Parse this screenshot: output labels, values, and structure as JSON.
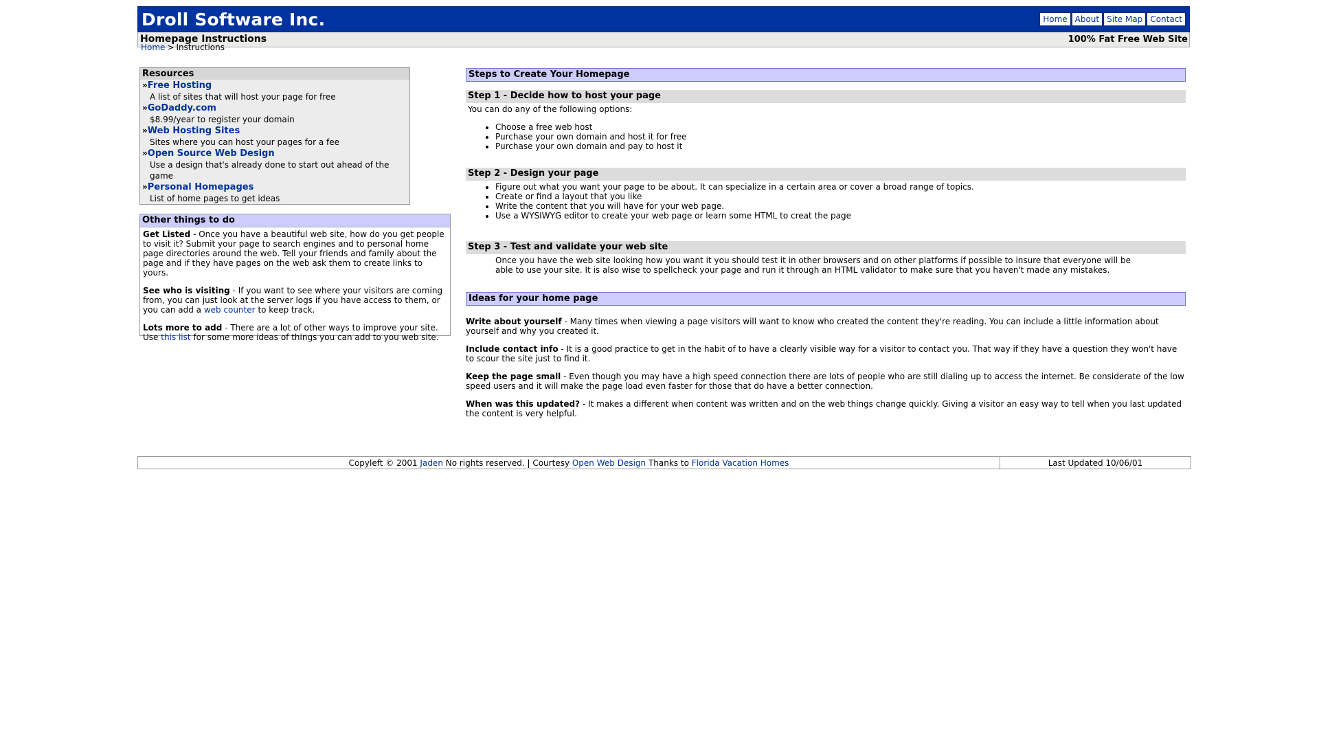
{
  "header": {
    "logo": "Droll Software Inc.",
    "nav": [
      "Home",
      "About",
      "Site Map",
      "Contact"
    ]
  },
  "subheader": {
    "left": "Homepage Instructions",
    "right": "100% Fat Free Web Site"
  },
  "breadcrumb": {
    "home": "Home",
    "separator": ">",
    "current": "Instructions"
  },
  "resources": {
    "title": "Resources",
    "bullet": "»",
    "items": [
      {
        "link": "Free Hosting",
        "desc": "A list of sites that will host your page for free"
      },
      {
        "link": "GoDaddy.com",
        "desc": "$8.99/year to register your domain"
      },
      {
        "link": "Web Hosting Sites",
        "desc": "Sites where you can host your pages for a fee"
      },
      {
        "link": "Open Source Web Design",
        "desc": "Use a design that's already done to start out ahead of the game"
      },
      {
        "link": "Personal Homepages",
        "desc": "List of home pages to get ideas"
      }
    ]
  },
  "other": {
    "title": "Other things to do",
    "p1_head": "Get Listed",
    "p1_text": " - Once you have a beautiful web site, how do you get people to visit it? Submit your page to search engines and to personal home page directories around the web. Tell your friends and family about the page and if they have pages on the web ask them to create links to yours.",
    "p2_head": "See who is visiting",
    "p2_text": " - If you want to see where your visitors are coming from, you can just look at the server logs if you have access to them, or you can add a ",
    "p2_link": "web counter",
    "p2_tail": " to keep track.",
    "p3_head": "Lots more to add",
    "p3_text": " - There are a lot of other ways to improve your site. Use ",
    "p3_link": "this list",
    "p3_tail": " for some more ideas of things you can add to you web site."
  },
  "steps": {
    "title": "Steps to Create Your Homepage",
    "step1": {
      "label": "Step 1",
      "title": " - Decide how to host your page",
      "intro": "You can do any of the following options:",
      "items": [
        "Choose a free web host",
        "Purchase your own domain and host it for free",
        "Purchase your own domain and pay to host it"
      ]
    },
    "step2": {
      "label": "Step 2",
      "title": " - Design your page",
      "items": [
        "Figure out what you want your page to be about. It can specialize in a certain area or cover a broad range of topics.",
        "Create or find a layout that you like",
        "Write the content that you will have for your web page.",
        "Use a WYSIWYG editor to create your web page or learn some HTML to creat the page"
      ]
    },
    "step3": {
      "label": "Step 3",
      "title": " - Test and validate your web site",
      "text": "Once you have the web site looking how you want it you should test it in other browsers and on other platforms if possible to insure that everyone will be able to use your site. It is also wise to spellcheck your page and run it through an HTML validator to make sure that you haven't made any mistakes."
    }
  },
  "ideas": {
    "title": "Ideas for your home page",
    "items": [
      {
        "head": "Write about yourself",
        "text": " - Many times when viewing a page visitors will want to know who created the content they're reading. You can include a little information about yourself and why you created it."
      },
      {
        "head": "Include contact info",
        "text": " - It is a good practice to get in the habit of to have a clearly visible way for a visitor to contact you. That way if they have a question they won't have to scour the site just to find it."
      },
      {
        "head": "Keep the page small",
        "text": " - Even though you may have a high speed connection there are lots of people who are still dialing up to access the internet. Be considerate of the low speed users and it will make the page load even faster for those that do have a better connection."
      },
      {
        "head": "When was this updated?",
        "text": " - It makes a different when content was written and on the web things change quickly. Giving a visitor an easy way to tell when you last updated the content is very helpful."
      }
    ]
  },
  "footer": {
    "copy": "Copyleft © 2001 ",
    "author": "Jaden",
    "mid": " No rights reserved. | Courtesy ",
    "courtesy": "Open Web Design",
    "thanks": " Thanks to ",
    "thanks_link": "Florida Vacation Homes",
    "updated": "Last Updated 10/06/01"
  }
}
